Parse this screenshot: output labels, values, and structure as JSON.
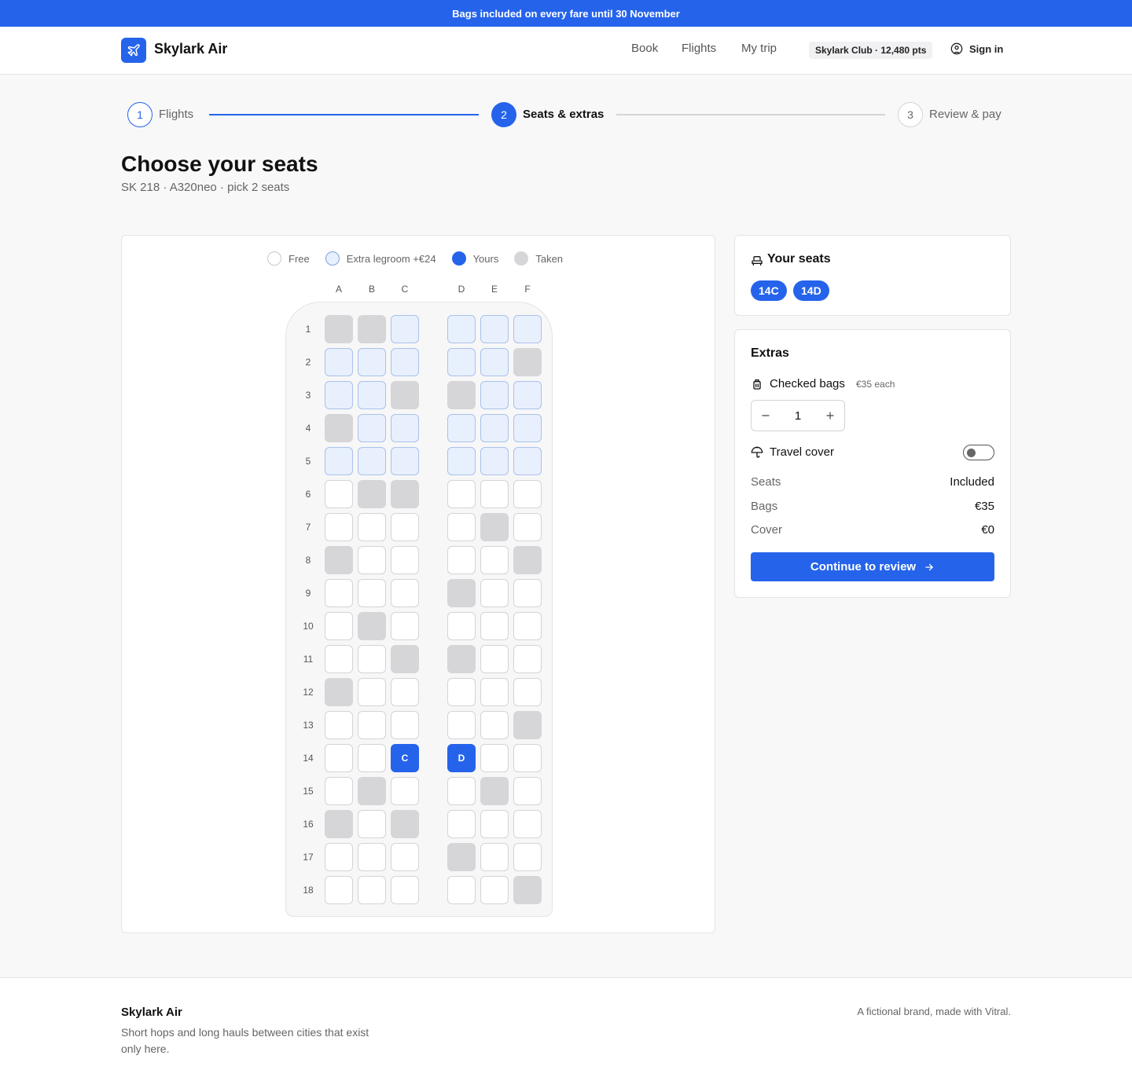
{
  "banner": {
    "text": "Bags included on every fare until 30 November"
  },
  "header": {
    "brand": "Skylark Air",
    "nav": [
      "Book",
      "Flights",
      "My trip"
    ],
    "club": "Skylark Club · 12,480 pts",
    "signin": "Sign in"
  },
  "steps": [
    {
      "num": "1",
      "label": "Flights",
      "state": "done"
    },
    {
      "num": "2",
      "label": "Seats & extras",
      "state": "active"
    },
    {
      "num": "3",
      "label": "Review & pay",
      "state": "todo"
    }
  ],
  "page": {
    "title": "Choose your seats",
    "subtitle": "SK 218 · A320neo · pick 2 seats"
  },
  "legend": {
    "free": "Free",
    "legroom": "Extra legroom +€24",
    "yours": "Yours",
    "taken": "Taken"
  },
  "seatmap": {
    "columns": [
      "A",
      "B",
      "C",
      "D",
      "E",
      "F"
    ],
    "rows": [
      {
        "num": "1",
        "seats": [
          "T",
          "T",
          "L",
          "L",
          "L",
          "L"
        ]
      },
      {
        "num": "2",
        "seats": [
          "L",
          "L",
          "L",
          "L",
          "L",
          "T"
        ]
      },
      {
        "num": "3",
        "seats": [
          "L",
          "L",
          "T",
          "T",
          "L",
          "L"
        ]
      },
      {
        "num": "4",
        "seats": [
          "T",
          "L",
          "L",
          "L",
          "L",
          "L"
        ]
      },
      {
        "num": "5",
        "seats": [
          "L",
          "L",
          "L",
          "L",
          "L",
          "L"
        ]
      },
      {
        "num": "6",
        "seats": [
          "F",
          "T",
          "T",
          "F",
          "F",
          "F"
        ]
      },
      {
        "num": "7",
        "seats": [
          "F",
          "F",
          "F",
          "F",
          "T",
          "F"
        ]
      },
      {
        "num": "8",
        "seats": [
          "T",
          "F",
          "F",
          "F",
          "F",
          "T"
        ]
      },
      {
        "num": "9",
        "seats": [
          "F",
          "F",
          "F",
          "T",
          "F",
          "F"
        ]
      },
      {
        "num": "10",
        "seats": [
          "F",
          "T",
          "F",
          "F",
          "F",
          "F"
        ]
      },
      {
        "num": "11",
        "seats": [
          "F",
          "F",
          "T",
          "T",
          "F",
          "F"
        ]
      },
      {
        "num": "12",
        "seats": [
          "T",
          "F",
          "F",
          "F",
          "F",
          "F"
        ]
      },
      {
        "num": "13",
        "seats": [
          "F",
          "F",
          "F",
          "F",
          "F",
          "T"
        ]
      },
      {
        "num": "14",
        "seats": [
          "F",
          "F",
          "Y",
          "Y",
          "F",
          "F"
        ]
      },
      {
        "num": "15",
        "seats": [
          "F",
          "T",
          "F",
          "F",
          "T",
          "F"
        ]
      },
      {
        "num": "16",
        "seats": [
          "T",
          "F",
          "T",
          "F",
          "F",
          "F"
        ]
      },
      {
        "num": "17",
        "seats": [
          "F",
          "F",
          "F",
          "T",
          "F",
          "F"
        ]
      },
      {
        "num": "18",
        "seats": [
          "F",
          "F",
          "F",
          "F",
          "F",
          "T"
        ]
      }
    ]
  },
  "your_seats": {
    "title": "Your seats",
    "chips": [
      "14C",
      "14D"
    ]
  },
  "extras": {
    "title": "Extras",
    "bags_label": "Checked bags",
    "bags_price": "€35 each",
    "bags_qty": "1",
    "cover_label": "Travel cover",
    "cover_on": false,
    "summary": [
      {
        "k": "Seats",
        "v": "Included"
      },
      {
        "k": "Bags",
        "v": "€35"
      },
      {
        "k": "Cover",
        "v": "€0"
      }
    ],
    "cta": "Continue to review"
  },
  "footer": {
    "brand": "Skylark Air",
    "tagline": "Short hops and long hauls between cities that exist only here.",
    "note": "A fictional brand, made with Vitral."
  },
  "colors": {
    "accent": "#2563eb",
    "legroom": "#e8f0fd",
    "taken": "#d6d6d9"
  }
}
